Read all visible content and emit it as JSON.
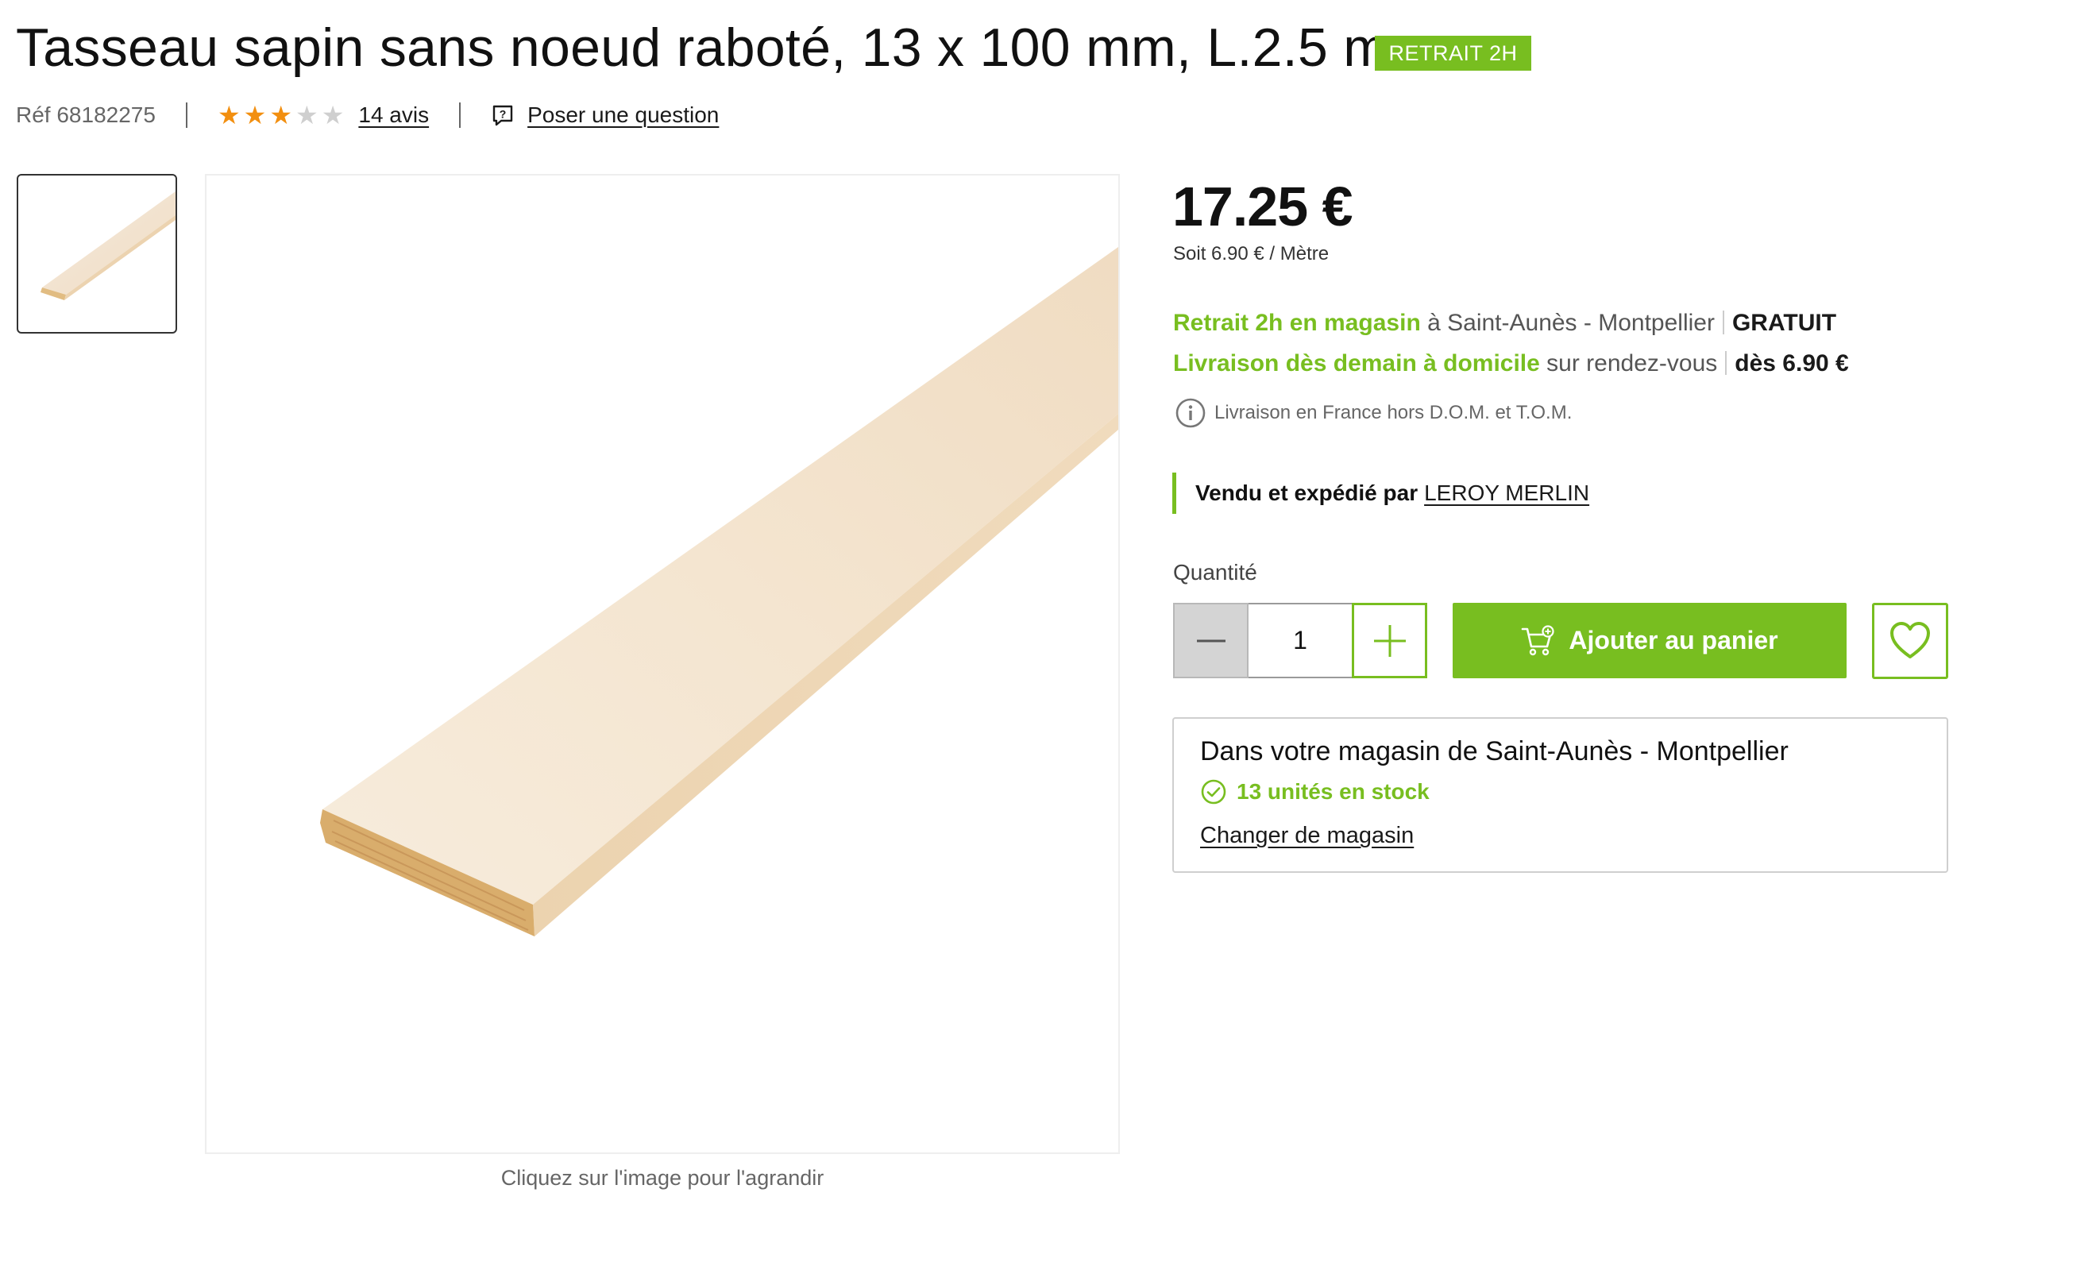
{
  "product": {
    "title": "Tasseau sapin sans noeud raboté, 13 x 100 mm, L.2.5 m",
    "badge": "RETRAIT 2H",
    "ref": "Réf 68182275",
    "rating": 3,
    "rating_max": 5,
    "reviews_label": "14 avis",
    "ask_question": "Poser une question",
    "image_caption": "Cliquez sur l'image pour l'agrandir"
  },
  "pricing": {
    "price": "17.25 €",
    "unit_price": "Soit 6.90 € / Mètre"
  },
  "delivery": {
    "pickup": {
      "highlight": "Retrait 2h en magasin",
      "detail": "à Saint-Aunès - Montpellier",
      "cost": "GRATUIT"
    },
    "home": {
      "highlight": "Livraison dès demain à domicile",
      "detail": "sur rendez-vous",
      "cost": "dès 6.90 €"
    },
    "note": "Livraison en France hors D.O.M. et T.O.M."
  },
  "seller": {
    "label": "Vendu et expédié par",
    "name": "LEROY MERLIN"
  },
  "purchase": {
    "quantity_label": "Quantité",
    "quantity": "1",
    "add_to_cart": "Ajouter au panier"
  },
  "store": {
    "title": "Dans votre magasin de Saint-Aunès - Montpellier",
    "stock": "13 unités en stock",
    "change": "Changer de magasin"
  },
  "colors": {
    "brand_green": "#78be20",
    "star_on": "#f28f10",
    "star_off": "#cfcfcf"
  },
  "icons": [
    "star-icon",
    "question-icon",
    "info-icon",
    "minus-icon",
    "plus-icon",
    "cart-icon",
    "heart-icon",
    "check-circle-icon"
  ]
}
